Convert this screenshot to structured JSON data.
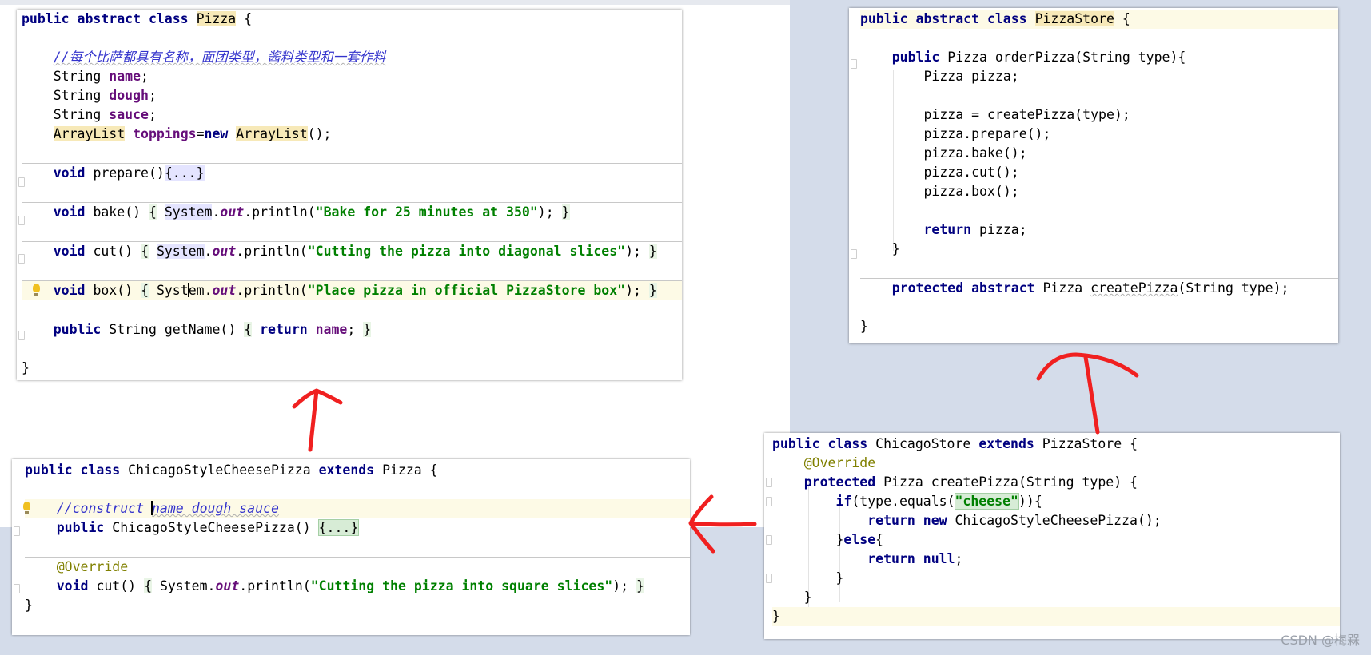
{
  "watermark": "CSDN @梅槑",
  "arrow_color": "#f02020",
  "pizza": {
    "title": "Pizza",
    "comment": "//每个比萨都具有名称，面团类型，酱料类型和一套作料",
    "f_name": "name",
    "f_dough": "dough",
    "f_sauce": "sauce",
    "f_toppings": "toppings",
    "t_string": "String",
    "t_arraylist": "ArrayList",
    "m_prepare": "prepare",
    "fold": "{...}",
    "m_bake": "bake",
    "s_bake": "\"Bake for 25 minutes at 350\"",
    "m_cut": "cut",
    "s_cut": "\"Cutting the pizza into diagonal slices\"",
    "m_box": "box",
    "s_box": "\"Place pizza in official PizzaStore box\"",
    "m_getname": "getName",
    "sys_a": "Syst",
    "sys_b": "em",
    "system": "System",
    "out": "out",
    "println": ".println(",
    "close_brace": "}"
  },
  "store": {
    "title": "PizzaStore",
    "m_order": "orderPizza",
    "t_pizza": "Pizza",
    "v_pizza": "pizza",
    "m_create": "createPizza",
    "param": "(String type)",
    "c_prepare": "pizza.prepare();",
    "c_bake": "pizza.bake();",
    "c_cut": "pizza.cut();",
    "c_box": "pizza.box();"
  },
  "chicago_pizza": {
    "title": "ChicagoStyleCheesePizza",
    "parent": "Pizza",
    "comment_a": "//construct ",
    "comment_b": "name dough sauce",
    "ctor": "ChicagoStyleCheesePizza",
    "fold": "{...}",
    "annotation": "@Override",
    "m_cut": "cut",
    "s_cut": "\"Cutting the pizza into square slices\""
  },
  "chicago_store": {
    "title": "ChicagoStore",
    "parent": "PizzaStore",
    "annotation": "@Override",
    "m_create": "createPizza",
    "param": "(String type)",
    "cond_a": "(type.equals(",
    "cheese": "\"cheese\"",
    "cond_b": ")){",
    "ret_obj": "ChicagoStyleCheesePizza();",
    "null": "null"
  }
}
